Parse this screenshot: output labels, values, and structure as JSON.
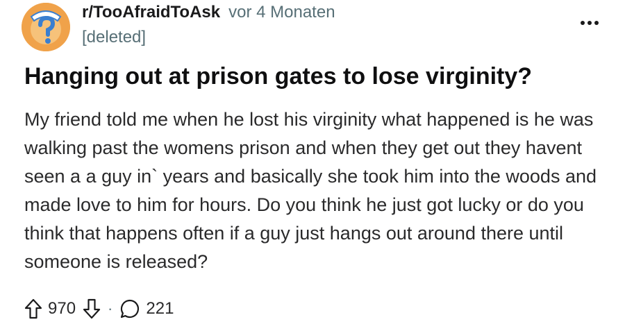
{
  "post": {
    "subreddit": "r/TooAfraidToAsk",
    "age": "vor 4 Monaten",
    "author": "[deleted]",
    "title": "Hanging out at prison gates to lose virginity?",
    "body": "My friend told me when he lost his virginity what happened is he was walking past the womens prison and when they get out they havent seen a a guy in` years and basically she took him into the woods and made love to him for hours. Do you think he just got lucky or do you think that happens often if a guy just hangs out around there until someone is released?",
    "upvotes": "970",
    "separator": "·",
    "comments": "221"
  },
  "icons": {
    "avatar": "subreddit-question-mark-avatar",
    "more": "more-options-icon",
    "upvote": "upvote-arrow-icon",
    "downvote": "downvote-arrow-icon",
    "comments": "comment-bubble-icon"
  },
  "colors": {
    "avatar_bg": "#f0a24a",
    "meta_gray": "#576f76",
    "text": "#1a1a1b"
  }
}
